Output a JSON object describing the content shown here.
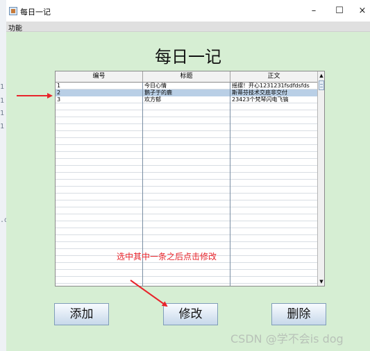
{
  "left_strip": {
    "marks": [
      "1",
      "1",
      "1",
      "1",
      ".d"
    ]
  },
  "window": {
    "title": "每日一记",
    "controls": {
      "minimize": "–",
      "maximize": "☐",
      "close": "×"
    }
  },
  "menubar": {
    "items": [
      {
        "label": "功能"
      }
    ]
  },
  "page_title": "每日一记",
  "table": {
    "columns": [
      "编号",
      "标题",
      "正文"
    ],
    "rows": [
      {
        "id": "1",
        "title": "今日心情",
        "body": "摇摆！开心1231231fsdfdsfds"
      },
      {
        "id": "2",
        "title": "鹅子于的鹿",
        "body": "斯蒂芬技术交底非交付"
      },
      {
        "id": "3",
        "title": "欢方郁",
        "body": "23423个梵琴闪电飞镐"
      }
    ],
    "selected_row": 1,
    "scroll_up": "▲",
    "scroll_down": "▼"
  },
  "annotation": "选中其中一条之后点击修改",
  "buttons": {
    "add": "添加",
    "edit": "修改",
    "delete": "删除"
  },
  "watermark": "CSDN @学不会is dog",
  "colors": {
    "window_bg": "#d6eed3",
    "selection": "#b9cfe6",
    "annotation": "#e8242b"
  }
}
